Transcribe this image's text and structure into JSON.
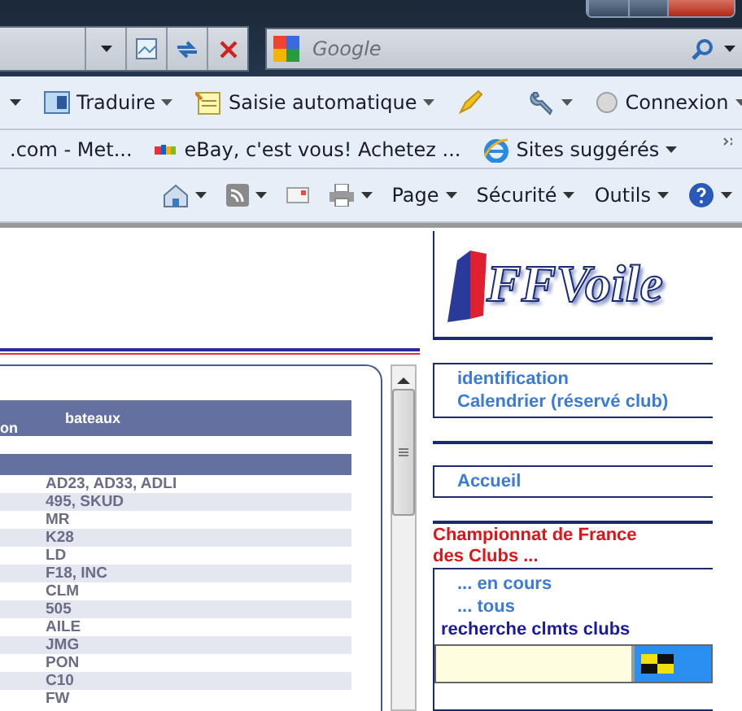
{
  "browser": {
    "search": {
      "placeholder": "Google"
    },
    "toolbar": [
      {
        "kind": "caret"
      },
      {
        "kind": "translate",
        "label": "Traduire"
      },
      {
        "kind": "autofill",
        "label": "Saisie automatique"
      },
      {
        "kind": "highlighter"
      },
      {
        "kind": "wrench"
      },
      {
        "kind": "signin",
        "label": "Connexion"
      }
    ],
    "favorites": [
      {
        "kind": "plain",
        "label": ".com - Met..."
      },
      {
        "kind": "ebay",
        "label": "eBay, c'est vous! Achetez ..."
      },
      {
        "kind": "ie",
        "label": "Sites suggérés"
      }
    ],
    "command_bar": [
      {
        "kind": "home"
      },
      {
        "kind": "rss"
      },
      {
        "kind": "mail"
      },
      {
        "kind": "print"
      },
      {
        "kind": "menu",
        "label": "Page"
      },
      {
        "kind": "menu",
        "label": "Sécurité"
      },
      {
        "kind": "menu",
        "label": "Outils"
      },
      {
        "kind": "help"
      }
    ]
  },
  "table": {
    "columns": [
      "on",
      "bateaux"
    ],
    "rows": [
      "AD23, AD33, ADLI",
      "495, SKUD",
      "MR",
      "K28",
      "LD",
      "F18, INC",
      "CLM",
      "505",
      "AILE",
      "JMG",
      "PON",
      "C10",
      "FW"
    ]
  },
  "sidebar": {
    "logo": "FFVoile",
    "links": [
      "identification",
      "Calendrier (réservé club)"
    ],
    "home_link": "Accueil",
    "section_title": "Championnat de France des Clubs ...",
    "section_links": [
      "... en cours",
      "... tous"
    ],
    "search_label": "recherche clmts clubs"
  }
}
